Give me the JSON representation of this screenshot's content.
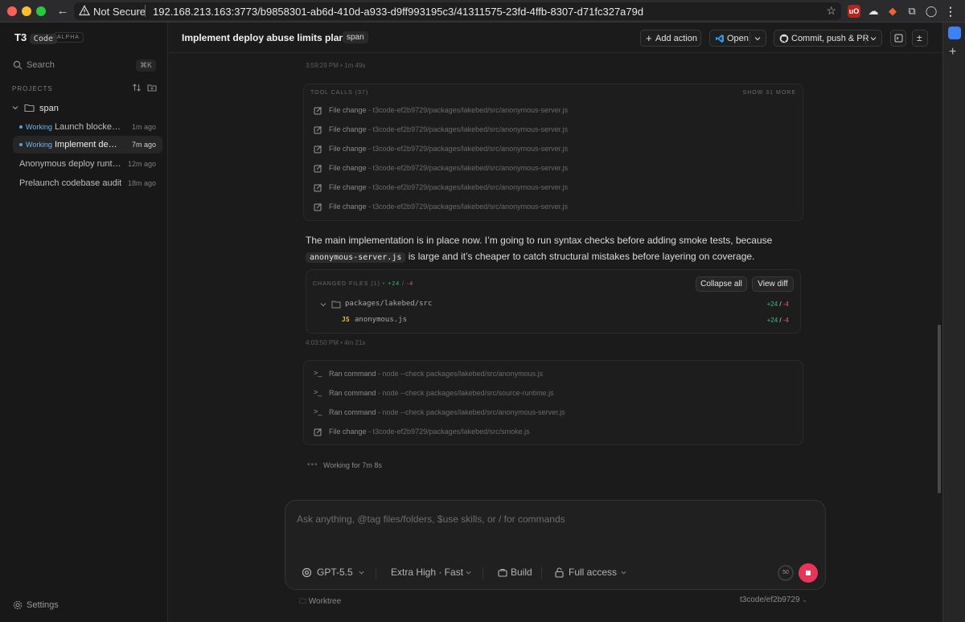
{
  "browser": {
    "security_label": "Not Secure",
    "url": "192.168.213.163:3773/b9858301-ab6d-410d-a933-d9ff993195c3/41311575-23fd-4ffb-8307-d71fc327a79d"
  },
  "sidebar": {
    "brand": "T3",
    "brand_suffix": "Code",
    "badge": "ALPHA",
    "search_label": "Search",
    "search_shortcut": "⌘K",
    "projects_heading": "PROJECTS",
    "project_name": "span",
    "threads": [
      {
        "status": "Working",
        "title": "Launch blocker ...",
        "time": "1m ago",
        "active": false
      },
      {
        "status": "Working",
        "title": "Implement depl...",
        "time": "7m ago",
        "active": true
      },
      {
        "status": "",
        "title": "Anonymous deploy runtim...",
        "time": "12m ago",
        "active": false
      },
      {
        "status": "",
        "title": "Prelaunch codebase audit",
        "time": "18m ago",
        "active": false
      }
    ],
    "settings_label": "Settings"
  },
  "header": {
    "title": "Implement deploy abuse limits plan",
    "chip": "span",
    "add_action": "Add action",
    "open": "Open",
    "commit": "Commit, push & PR"
  },
  "chat": {
    "timestamp_1": "3:59:29 PM • 1m 49s",
    "tool_calls_heading": "TOOL CALLS (37)",
    "show_more": "SHOW 31 MORE",
    "tool_calls": [
      {
        "label": "File change",
        "detail": " - t3code-ef2b9729/packages/lakebed/src/anonymous-server.js"
      },
      {
        "label": "File change",
        "detail": " - t3code-ef2b9729/packages/lakebed/src/anonymous-server.js"
      },
      {
        "label": "File change",
        "detail": " - t3code-ef2b9729/packages/lakebed/src/anonymous-server.js"
      },
      {
        "label": "File change",
        "detail": " - t3code-ef2b9729/packages/lakebed/src/anonymous-server.js"
      },
      {
        "label": "File change",
        "detail": " - t3code-ef2b9729/packages/lakebed/src/anonymous-server.js"
      },
      {
        "label": "File change",
        "detail": " - t3code-ef2b9729/packages/lakebed/src/anonymous-server.js"
      }
    ],
    "message_line1": "The main implementation is in place now. I’m going to run syntax checks before adding smoke tests, because",
    "message_code": "anonymous-server.js",
    "message_line2_rest": " is large and it’s cheaper to catch structural mistakes before layering on coverage.",
    "changed_files_heading": "CHANGED FILES (1) •",
    "changed_add": "+24",
    "changed_sep": " / ",
    "changed_del": "-4",
    "collapse_all": "Collapse all",
    "view_diff": "View diff",
    "dir_name": "packages/lakebed/src",
    "dir_add": "+24",
    "dir_del": "-4",
    "file_badge": "JS",
    "file_name": "anonymous.js",
    "file_add": "+24",
    "file_del": "-4",
    "timestamp_2": "4:03:50 PM • 4m 21s",
    "commands": [
      {
        "icon": "terminal-icon",
        "label": "Ran command",
        "detail": " - node --check packages/lakebed/src/anonymous.js"
      },
      {
        "icon": "terminal-icon",
        "label": "Ran command",
        "detail": " - node --check packages/lakebed/src/source-runtime.js"
      },
      {
        "icon": "terminal-icon",
        "label": "Ran command",
        "detail": " - node --check packages/lakebed/src/anonymous-server.js"
      },
      {
        "icon": "file-edit-icon",
        "label": "File change",
        "detail": " - t3code-ef2b9729/packages/lakebed/src/smoke.js"
      }
    ],
    "working_status": "Working for 7m 8s"
  },
  "composer": {
    "placeholder": "Ask anything, @tag files/folders, $use skills, or / for commands",
    "model": "GPT-5.5",
    "reasoning": "Extra High · Fast",
    "mode": "Build",
    "access": "Full access",
    "context_usage": "50",
    "worktree_label": "Worktree",
    "branch": "t3code/ef2b9729"
  },
  "colors": {
    "accent_working": "#6fb6ef",
    "additions": "#3fb97a",
    "deletions": "#e05d5d",
    "stop": "#e8365b"
  }
}
